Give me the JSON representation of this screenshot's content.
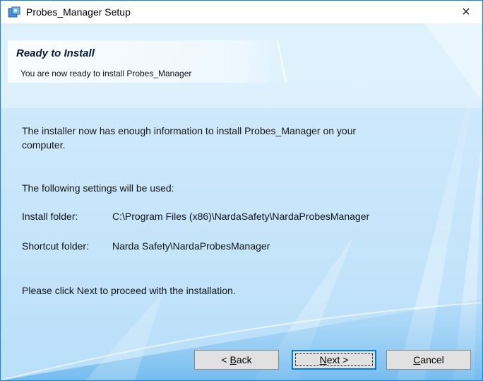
{
  "window": {
    "title": "Probes_Manager Setup",
    "close_glyph": "×"
  },
  "header": {
    "title": "Ready to Install",
    "subtitle": "You are now ready to install Probes_Manager"
  },
  "body": {
    "intro_line1": "The installer now has enough information to install Probes_Manager on your",
    "intro_line2": "computer.",
    "settings_heading": "The following settings will be used:",
    "install_folder_label": "Install folder:",
    "install_folder_value": "C:\\Program Files (x86)\\NardaSafety\\NardaProbesManager",
    "shortcut_folder_label": "Shortcut folder:",
    "shortcut_folder_value": "Narda Safety\\NardaProbesManager",
    "instruction": "Please click Next to proceed with the installation."
  },
  "buttons": {
    "back_prefix": "< ",
    "back_mnemonic": "B",
    "back_rest": "ack",
    "next_mnemonic": "N",
    "next_rest": "ext >",
    "cancel_mnemonic": "C",
    "cancel_rest": "ancel"
  },
  "colors": {
    "accent": "#0078d7",
    "background": "#c9e6fb"
  }
}
